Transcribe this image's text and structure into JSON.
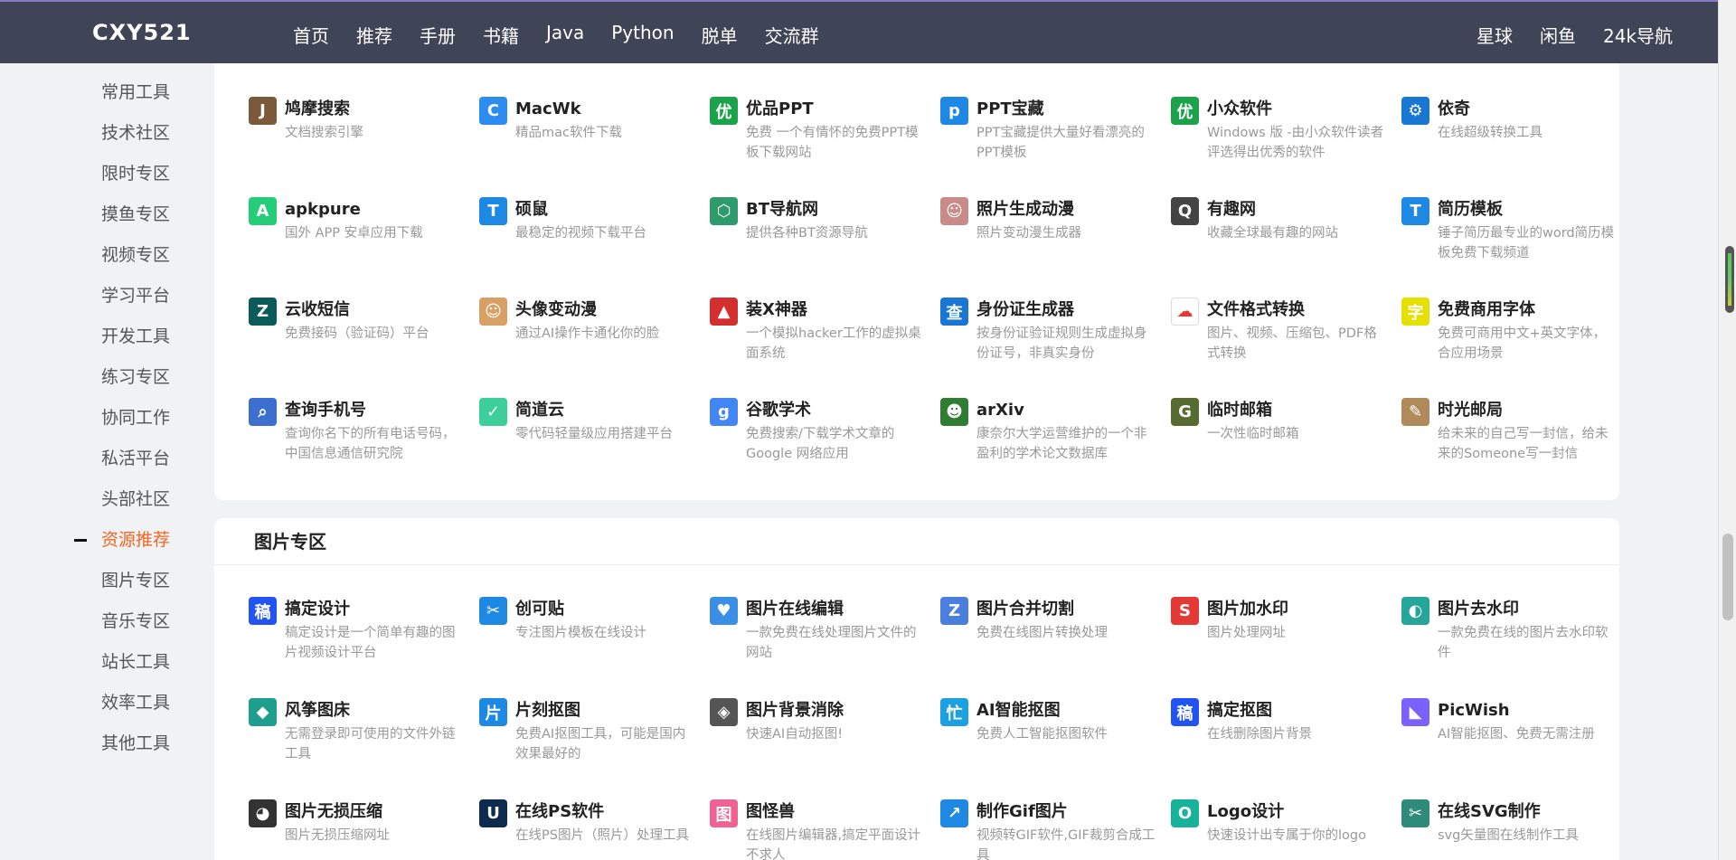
{
  "header": {
    "logo": "CXY521",
    "nav": [
      "首页",
      "推荐",
      "手册",
      "书籍",
      "Java",
      "Python",
      "脱单",
      "交流群"
    ],
    "nav_right": [
      "星球",
      "闲鱼",
      "24k导航"
    ]
  },
  "sidebar": {
    "active_index": 11,
    "items": [
      "常用工具",
      "技术社区",
      "限时专区",
      "摸鱼专区",
      "视频专区",
      "学习平台",
      "开发工具",
      "练习专区",
      "协同工作",
      "私活平台",
      "头部社区",
      "资源推荐",
      "图片专区",
      "音乐专区",
      "站长工具",
      "效率工具",
      "其他工具"
    ]
  },
  "resources_section": {
    "items": [
      {
        "name": "鸠摩搜索",
        "desc": "文档搜索引擎",
        "icon": "jiumo-icon",
        "glyph": "J",
        "color": "#7a5a3a"
      },
      {
        "name": "MacWk",
        "desc": "精品mac软件下载",
        "icon": "macwk-icon",
        "glyph": "C",
        "color": "#2d8cf0"
      },
      {
        "name": "优品PPT",
        "desc": "免费 一个有情怀的免费PPT模板下载网站",
        "icon": "youpin-ppt-icon",
        "glyph": "优",
        "color": "#1aa34a"
      },
      {
        "name": "PPT宝藏",
        "desc": "PPT宝藏提供大量好看漂亮的PPT模板",
        "icon": "ppt-baozang-icon",
        "glyph": "p",
        "color": "#1e88e5"
      },
      {
        "name": "小众软件",
        "desc": "Windows 版 -由小众软件读者评选得出优秀的软件",
        "icon": "xiaozhong-icon",
        "glyph": "优",
        "color": "#1aa34a"
      },
      {
        "name": "依奇",
        "desc": "在线超级转换工具",
        "icon": "gear-icon",
        "glyph": "⚙",
        "color": "#1976d2"
      },
      {
        "name": "apkpure",
        "desc": "国外 APP 安卓应用下载",
        "icon": "apkpure-icon",
        "glyph": "A",
        "color": "#24cd77"
      },
      {
        "name": "硕鼠",
        "desc": "最稳定的视频下载平台",
        "icon": "shuoshu-icon",
        "glyph": "T",
        "color": "#1e88e5"
      },
      {
        "name": "BT导航网",
        "desc": "提供各种BT资源导航",
        "icon": "bt-nav-icon",
        "glyph": "⬡",
        "color": "#2e9b6b"
      },
      {
        "name": "照片生成动漫",
        "desc": "照片变动漫生成器",
        "icon": "anime-photo-icon",
        "glyph": "☺",
        "color": "#c98a8a"
      },
      {
        "name": "有趣网",
        "desc": "收藏全球最有趣的网站",
        "icon": "youqu-icon",
        "glyph": "Q",
        "color": "#444444"
      },
      {
        "name": "简历模板",
        "desc": "锤子简历最专业的word简历模板免费下载频道",
        "icon": "resume-icon",
        "glyph": "T",
        "color": "#1e88e5"
      },
      {
        "name": "云收短信",
        "desc": "免费接码（验证码）平台",
        "icon": "yunshou-icon",
        "glyph": "Z",
        "color": "#0b5b5b"
      },
      {
        "name": "头像变动漫",
        "desc": "通过AI操作卡通化你的脸",
        "icon": "avatar-anime-icon",
        "glyph": "☺",
        "color": "#d9a066"
      },
      {
        "name": "装X神器",
        "desc": "一个模拟hacker工作的虚拟桌面系统",
        "icon": "zhuangx-icon",
        "glyph": "▲",
        "color": "#d32f2f"
      },
      {
        "name": "身份证生成器",
        "desc": "按身份证验证规则生成虚拟身份证号，非真实身份",
        "icon": "id-card-icon",
        "glyph": "查",
        "color": "#1976d2"
      },
      {
        "name": "文件格式转换",
        "desc": "图片、视频、压缩包、PDF格式转换",
        "icon": "cloud-convert-icon",
        "glyph": "☁",
        "color": "#ffffff"
      },
      {
        "name": "免费商用字体",
        "desc": "免费可商用中文+英文字体，合应用场景",
        "icon": "font-icon",
        "glyph": "字",
        "color": "#e5e000"
      },
      {
        "name": "查询手机号",
        "desc": "查询你名下的所有电话号码，中国信息通信研究院",
        "icon": "phone-query-icon",
        "glyph": "⌕",
        "color": "#3d6fd1"
      },
      {
        "name": "简道云",
        "desc": "零代码轻量级应用搭建平台",
        "icon": "jiandaoyun-icon",
        "glyph": "✓",
        "color": "#3ccf9a"
      },
      {
        "name": "谷歌学术",
        "desc": "免费搜索/下载学术文章的 Google 网络应用",
        "icon": "google-scholar-icon",
        "glyph": "g",
        "color": "#4285f4"
      },
      {
        "name": "arXiv",
        "desc": "康奈尔大学运营维护的一个非盈利的学术论文数据库",
        "icon": "arxiv-icon",
        "glyph": "☻",
        "color": "#2e7d32"
      },
      {
        "name": "临时邮箱",
        "desc": "一次性临时邮箱",
        "icon": "temp-mail-icon",
        "glyph": "G",
        "color": "#556b2f"
      },
      {
        "name": "时光邮局",
        "desc": "给未来的自己写一封信，给未来的Someone写一封信",
        "icon": "time-post-icon",
        "glyph": "✎",
        "color": "#b08a5a"
      }
    ]
  },
  "image_section": {
    "title": "图片专区",
    "items": [
      {
        "name": "搞定设计",
        "desc": "稿定设计是一个简单有趣的图片视频设计平台",
        "icon": "gaoding-icon",
        "glyph": "稿",
        "color": "#2254f4"
      },
      {
        "name": "创可贴",
        "desc": "专注图片模板在线设计",
        "icon": "chuangkit-icon",
        "glyph": "✂",
        "color": "#1e88e5"
      },
      {
        "name": "图片在线编辑",
        "desc": "一款免费在线处理图片文件的网站",
        "icon": "heart-edit-icon",
        "glyph": "♥",
        "color": "#3a8ee6"
      },
      {
        "name": "图片合并切割",
        "desc": "免费在线图片转换处理",
        "icon": "merge-cut-icon",
        "glyph": "Z",
        "color": "#4a7fe0"
      },
      {
        "name": "图片加水印",
        "desc": "图片处理网址",
        "icon": "watermark-add-icon",
        "glyph": "S",
        "color": "#e53935"
      },
      {
        "name": "图片去水印",
        "desc": "一款免费在线的图片去水印软件",
        "icon": "watermark-remove-icon",
        "glyph": "◐",
        "color": "#26a69a"
      },
      {
        "name": "风筝图床",
        "desc": "无需登录即可使用的文件外链工具",
        "icon": "kite-icon",
        "glyph": "◆",
        "color": "#1e9e8e"
      },
      {
        "name": "片刻抠图",
        "desc": "免费AI抠图工具，可能是国内效果最好的",
        "icon": "pianke-icon",
        "glyph": "片",
        "color": "#1e88e5"
      },
      {
        "name": "图片背景消除",
        "desc": "快速AI自动抠图!",
        "icon": "remove-bg-icon",
        "glyph": "◈",
        "color": "#555555"
      },
      {
        "name": "AI智能抠图",
        "desc": "免费人工智能抠图软件",
        "icon": "ai-cutout-icon",
        "glyph": "忙",
        "color": "#1ba1e2"
      },
      {
        "name": "搞定抠图",
        "desc": "在线删除图片背景",
        "icon": "gaoding-cutout-icon",
        "glyph": "稿",
        "color": "#2254f4"
      },
      {
        "name": "PicWish",
        "desc": "AI智能抠图、免费无需注册",
        "icon": "picwish-icon",
        "glyph": "◣",
        "color": "#7b61ff"
      },
      {
        "name": "图片无损压缩",
        "desc": "图片无损压缩网址",
        "icon": "panda-icon",
        "glyph": "◕",
        "color": "#333333"
      },
      {
        "name": "在线PS软件",
        "desc": "在线PS图片（照片）处理工具",
        "icon": "online-ps-icon",
        "glyph": "U",
        "color": "#0d2b4e"
      },
      {
        "name": "图怪兽",
        "desc": "在线图片编辑器,搞定平面设计不求人",
        "icon": "tuguaishou-icon",
        "glyph": "图",
        "color": "#f06292"
      },
      {
        "name": "制作Gif图片",
        "desc": "视频转GIF软件,GIF裁剪合成工具",
        "icon": "gif-maker-icon",
        "glyph": "↗",
        "color": "#1e88e5"
      },
      {
        "name": "Logo设计",
        "desc": "快速设计出专属于你的logo",
        "icon": "logo-design-icon",
        "glyph": "O",
        "color": "#16b39a"
      },
      {
        "name": "在线SVG制作",
        "desc": "svg矢量图在线制作工具",
        "icon": "svg-maker-icon",
        "glyph": "✂",
        "color": "#2e8b7a"
      }
    ]
  }
}
